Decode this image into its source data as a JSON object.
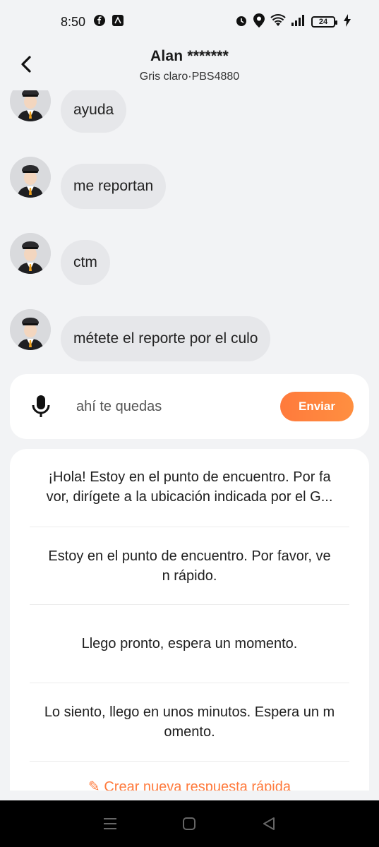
{
  "status_bar": {
    "time": "8:50",
    "left_icons": [
      "facebook-icon",
      "app-notification-icon"
    ],
    "right_icons": [
      "alarm-icon",
      "location-icon",
      "wifi-icon",
      "signal-icon",
      "battery-icon",
      "charging-icon"
    ],
    "battery_level": "24"
  },
  "header": {
    "title": "Alan *******",
    "subtitle": "Gris claro·PBS4880"
  },
  "messages": [
    {
      "text": "ayuda"
    },
    {
      "text": "me reportan"
    },
    {
      "text": "ctm"
    },
    {
      "text": "métete el reporte por el culo"
    }
  ],
  "composer": {
    "value": "ahí te quedas",
    "send_label": "Enviar"
  },
  "quick_replies": [
    {
      "line1": "¡Hola! Estoy en el punto de encuentro. Por fa",
      "line2": "vor, dirígete a la ubicación indicada por el G..."
    },
    {
      "line1": "Estoy en el punto de encuentro. Por favor, ve",
      "line2": "n rápido."
    },
    {
      "line1": "Llego pronto, espera un momento.",
      "line2": ""
    },
    {
      "line1": "Lo siento, llego en unos minutos. Espera un m",
      "line2": "omento."
    }
  ],
  "create_quick_reply": "✎ Crear nueva respuesta rápida",
  "colors": {
    "accent": "#ff7a3c",
    "bubble": "#e6e7ea",
    "background": "#f2f3f5"
  }
}
